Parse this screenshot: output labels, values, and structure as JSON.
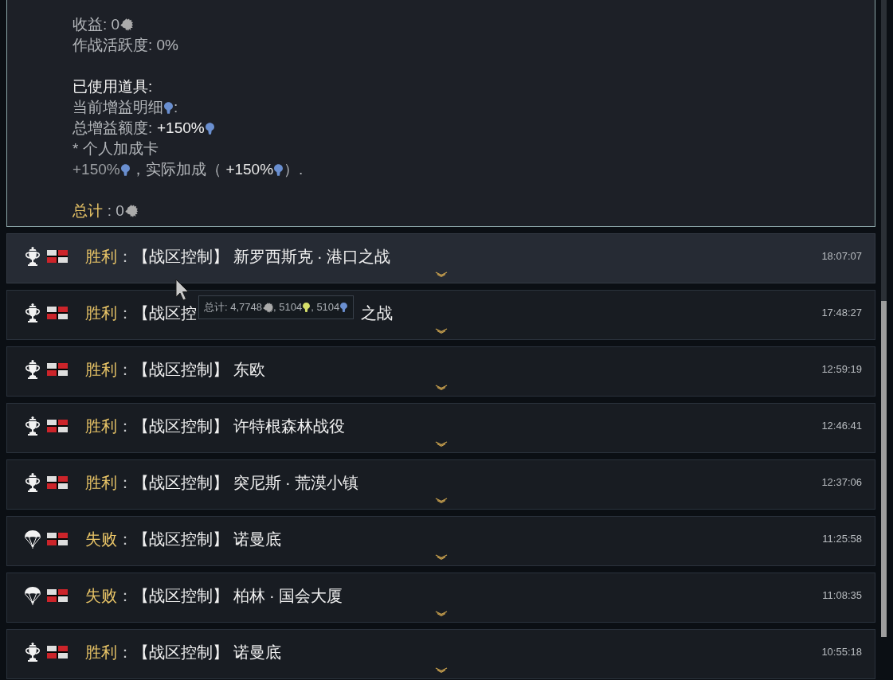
{
  "detail_panel": {
    "blocks": [
      {
        "lines": [
          {
            "segments": [
              {
                "kind": "text",
                "text": "收益: 0"
              },
              {
                "kind": "coin"
              }
            ]
          },
          {
            "segments": [
              {
                "kind": "text",
                "text": "作战活跃度: 0%"
              }
            ]
          }
        ]
      },
      {
        "lines": [
          {
            "segments": [
              {
                "kind": "text",
                "text": "已使用道具:",
                "color": "#f2f2f2"
              }
            ]
          },
          {
            "segments": [
              {
                "kind": "text",
                "text": "当前增益明细"
              },
              {
                "kind": "bulb",
                "color": "#6a8fd0"
              },
              {
                "kind": "text",
                "text": ":"
              }
            ]
          },
          {
            "segments": [
              {
                "kind": "text",
                "text": "总增益额度:"
              },
              {
                "kind": "text",
                "text": "+150%",
                "color": "#f2f2f2"
              },
              {
                "kind": "bulb",
                "color": "#6a8fd0"
              }
            ]
          },
          {
            "segments": [
              {
                "kind": "text",
                "text": "* 个人加成卡"
              }
            ]
          },
          {
            "segments": [
              {
                "kind": "text",
                "text": "+150%",
                "color": "#9a9da1"
              },
              {
                "kind": "bulb",
                "color": "#6a8fd0"
              },
              {
                "kind": "text",
                "text": "，实际加成（"
              },
              {
                "kind": "text",
                "text": "+150%",
                "color": "#e6e6e6"
              },
              {
                "kind": "bulb",
                "color": "#6a8fd0"
              },
              {
                "kind": "text",
                "text": "）."
              }
            ]
          }
        ]
      },
      {
        "lines": [
          {
            "segments": [
              {
                "kind": "text",
                "text": "总计",
                "color": "#e8c467"
              },
              {
                "kind": "text",
                "text": ": 0"
              },
              {
                "kind": "coin"
              }
            ]
          }
        ]
      }
    ]
  },
  "rows": [
    {
      "kind": "victory",
      "hovered": true,
      "result": "胜利",
      "separator": "：",
      "title": "【战区控制】 新罗西斯克 · 港口之战",
      "time": "18:07:07"
    },
    {
      "kind": "victory",
      "hovered": false,
      "result": "胜利",
      "separator": "：",
      "title": "【战区控",
      "title_end": "之战",
      "time": "17:48:27"
    },
    {
      "kind": "victory",
      "hovered": false,
      "result": "胜利",
      "separator": "：",
      "title": "【战区控制】 东欧",
      "time": "12:59:19"
    },
    {
      "kind": "victory",
      "hovered": false,
      "result": "胜利",
      "separator": "：",
      "title": "【战区控制】 许特根森林战役",
      "time": "12:46:41"
    },
    {
      "kind": "victory",
      "hovered": false,
      "result": "胜利",
      "separator": "：",
      "title": "【战区控制】 突尼斯 · 荒漠小镇",
      "time": "12:37:06"
    },
    {
      "kind": "defeat",
      "hovered": false,
      "result": "失败",
      "separator": "：",
      "title": "【战区控制】 诺曼底",
      "time": "11:25:58"
    },
    {
      "kind": "defeat",
      "hovered": false,
      "result": "失败",
      "separator": "：",
      "title": "【战区控制】 柏林 · 国会大厦",
      "time": "11:08:35"
    },
    {
      "kind": "victory",
      "hovered": false,
      "result": "胜利",
      "separator": "：",
      "title": "【战区控制】 诺曼底",
      "time": "10:55:18"
    }
  ],
  "tooltip": {
    "segments": [
      {
        "kind": "text",
        "text": "总计: 4,7748"
      },
      {
        "kind": "coin"
      },
      {
        "kind": "text",
        "text": ", 5104"
      },
      {
        "kind": "bulb",
        "color": "#d6df6a"
      },
      {
        "kind": "text",
        "text": ", 5104"
      },
      {
        "kind": "bulb",
        "color": "#6a8fd0"
      }
    ]
  }
}
